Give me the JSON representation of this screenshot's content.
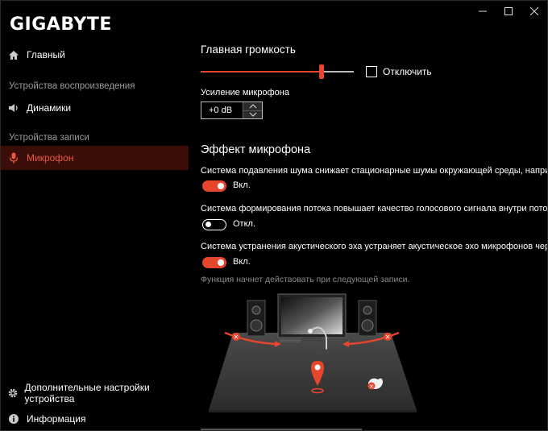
{
  "app": {
    "logo": "GIGABYTE"
  },
  "window_controls": {
    "minimize": "minimize-icon",
    "maximize": "maximize-icon",
    "close": "close-icon"
  },
  "sidebar": {
    "home": "Главный",
    "section_playback": "Устройства воспроизведения",
    "speakers": "Динамики",
    "section_recording": "Устройства записи",
    "microphone": "Микрофон",
    "advanced": "Дополнительные настройки устройства",
    "info": "Информация"
  },
  "main": {
    "volume_title": "Главная громкость",
    "volume_level": 0.79,
    "mute_label": "Отключить",
    "mute_checked": false,
    "mic_boost_label": "Усиление микрофона",
    "mic_boost_value": "+0 dB",
    "effect_title": "Эффект микрофона",
    "noise_desc": "Система подавления шума снижает стационарные шумы окружающей среды, например, шу",
    "noise_state": "Вкл.",
    "beam_desc": "Система формирования потока повышает качество голосового сигнала внутри потока, пода",
    "beam_state": "Откл.",
    "echo_desc": "Система устранения акустического эха устраняет акустическое эхо микрофонов через выхо",
    "echo_state": "Вкл.",
    "note": "Функция начнет действовать при следующей записи."
  },
  "colors": {
    "accent": "#e8452d",
    "active_bg": "#3a0d08",
    "muted_text": "#9a9a9a"
  }
}
